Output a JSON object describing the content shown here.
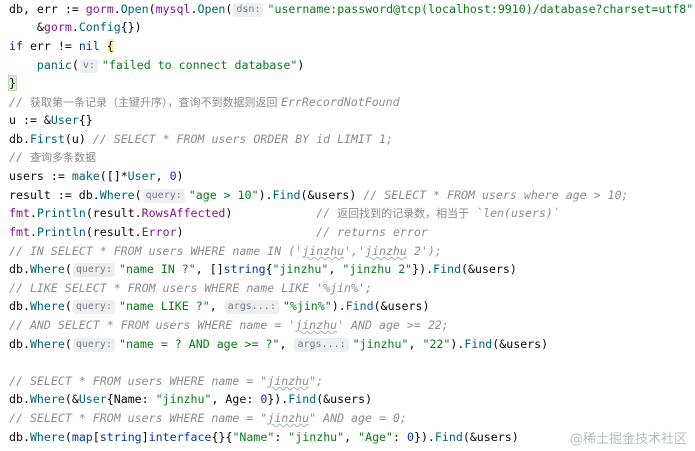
{
  "watermark": "@稀土掘金技术社区",
  "code": {
    "l1": {
      "a": "db, err := ",
      "b": "gorm",
      "c": ".",
      "d": "Open",
      "e": "(",
      "f": "mysql",
      "g": ".",
      "h": "Open",
      "i": "(",
      "hint": "dsn:",
      "j": "\"username:password@tcp(localhost:9910)/database?charset=utf8\"",
      "k": "),"
    },
    "l2": {
      "a": "    &",
      "b": "gorm",
      "c": ".",
      "d": "Config",
      "e": "{})"
    },
    "l3": {
      "a": "if",
      "b": " err != ",
      "c": "nil",
      "d": " ",
      "e": "{"
    },
    "l4": {
      "a": "    ",
      "b": "panic",
      "c": "(",
      "hint": "v:",
      "d": "\"failed to connect database\"",
      "e": ")"
    },
    "l5": {
      "a": "}"
    },
    "l6": {
      "a": "// ",
      "b": "获取第一条记录（主键升序），查询不到数据则返回 ",
      "c": "ErrRecordNotFound"
    },
    "l7": {
      "a": "u := &",
      "b": "User",
      "c": "{}"
    },
    "l8": {
      "a": "db.",
      "b": "First",
      "c": "(u) ",
      "d": "// SELECT * FROM users ORDER BY id LIMIT 1;"
    },
    "l9": {
      "a": "// ",
      "b": "查询多条数据"
    },
    "l10": {
      "a": "users := ",
      "b": "make",
      "c": "([]*",
      "d": "User",
      "e": ", ",
      "f": "0",
      "g": ")"
    },
    "l11": {
      "a": "result := db.",
      "b": "Where",
      "c": "(",
      "hint": "query:",
      "d": "\"age > 10\"",
      "e": ").",
      "f": "Find",
      "g": "(&users) ",
      "h": "// SELECT * FROM users where age > 10;"
    },
    "l12": {
      "a": "fmt",
      "b": ".",
      "c": "Println",
      "d": "(result.",
      "e": "RowsAffected",
      "f": ")            ",
      "g": "// ",
      "h": "返回找到的记录数，相当于",
      "i": " `len(users)`"
    },
    "l13": {
      "a": "fmt",
      "b": ".",
      "c": "Println",
      "d": "(result.",
      "e": "Error",
      "f": ")                   ",
      "g": "// returns error"
    },
    "l14": {
      "a": "// IN SELECT * FROM users WHERE name IN ('",
      "b": "jinzhu",
      "c": "','",
      "d": "jinzhu",
      "e": " 2');"
    },
    "l15": {
      "a": "db.",
      "b": "Where",
      "c": "(",
      "hint": "query:",
      "d": "\"name IN ?\"",
      "e": ", []",
      "f": "string",
      "g": "{",
      "h": "\"jinzhu\"",
      "i": ", ",
      "j": "\"jinzhu 2\"",
      "k": "}).",
      "l": "Find",
      "m": "(&users)"
    },
    "l16": {
      "a": "// LIKE SELECT * FROM users WHERE name LIKE '%jin%';"
    },
    "l17": {
      "a": "db.",
      "b": "Where",
      "c": "(",
      "hint": "query:",
      "d": "\"name LIKE ?\"",
      "e": ", ",
      "hint2": "args...:",
      "f": "\"%jin%\"",
      "g": ").",
      "h": "Find",
      "i": "(&users)"
    },
    "l18": {
      "a": "// AND SELECT * FROM users WHERE name = '",
      "b": "jinzhu",
      "c": "' AND age >= 22;"
    },
    "l19": {
      "a": "db.",
      "b": "Where",
      "c": "(",
      "hint": "query:",
      "d": "\"name = ? AND age >= ?\"",
      "e": ", ",
      "hint2": "args...:",
      "f": "\"jinzhu\"",
      "g": ", ",
      "h": "\"22\"",
      "i": ").",
      "j": "Find",
      "k": "(&users)"
    },
    "l20": {
      "a": ""
    },
    "l21": {
      "a": "// SELECT * FROM users WHERE name = \"",
      "b": "jinzhu",
      "c": "\";"
    },
    "l22": {
      "a": "db.",
      "b": "Where",
      "c": "(&",
      "d": "User",
      "e": "{Name: ",
      "f": "\"jinzhu\"",
      "g": ", Age: ",
      "h": "0",
      "i": "}).",
      "j": "Find",
      "k": "(&users)"
    },
    "l23": {
      "a": "// SELECT * FROM users WHERE name = \"",
      "b": "jinzhu",
      "c": "\" AND age = 0;"
    },
    "l24": {
      "a": "db.",
      "b": "Where",
      "c": "(",
      "d": "map",
      "e": "[",
      "f": "string",
      "g": "]",
      "h": "interface",
      "i": "{}{",
      "j": "\"Name\"",
      "k": ": ",
      "l": "\"jinzhu\"",
      "m": ", ",
      "n": "\"Age\"",
      "o": ": ",
      "p": "0",
      "q": "}).",
      "r": "Find",
      "s": "(&users)"
    }
  }
}
